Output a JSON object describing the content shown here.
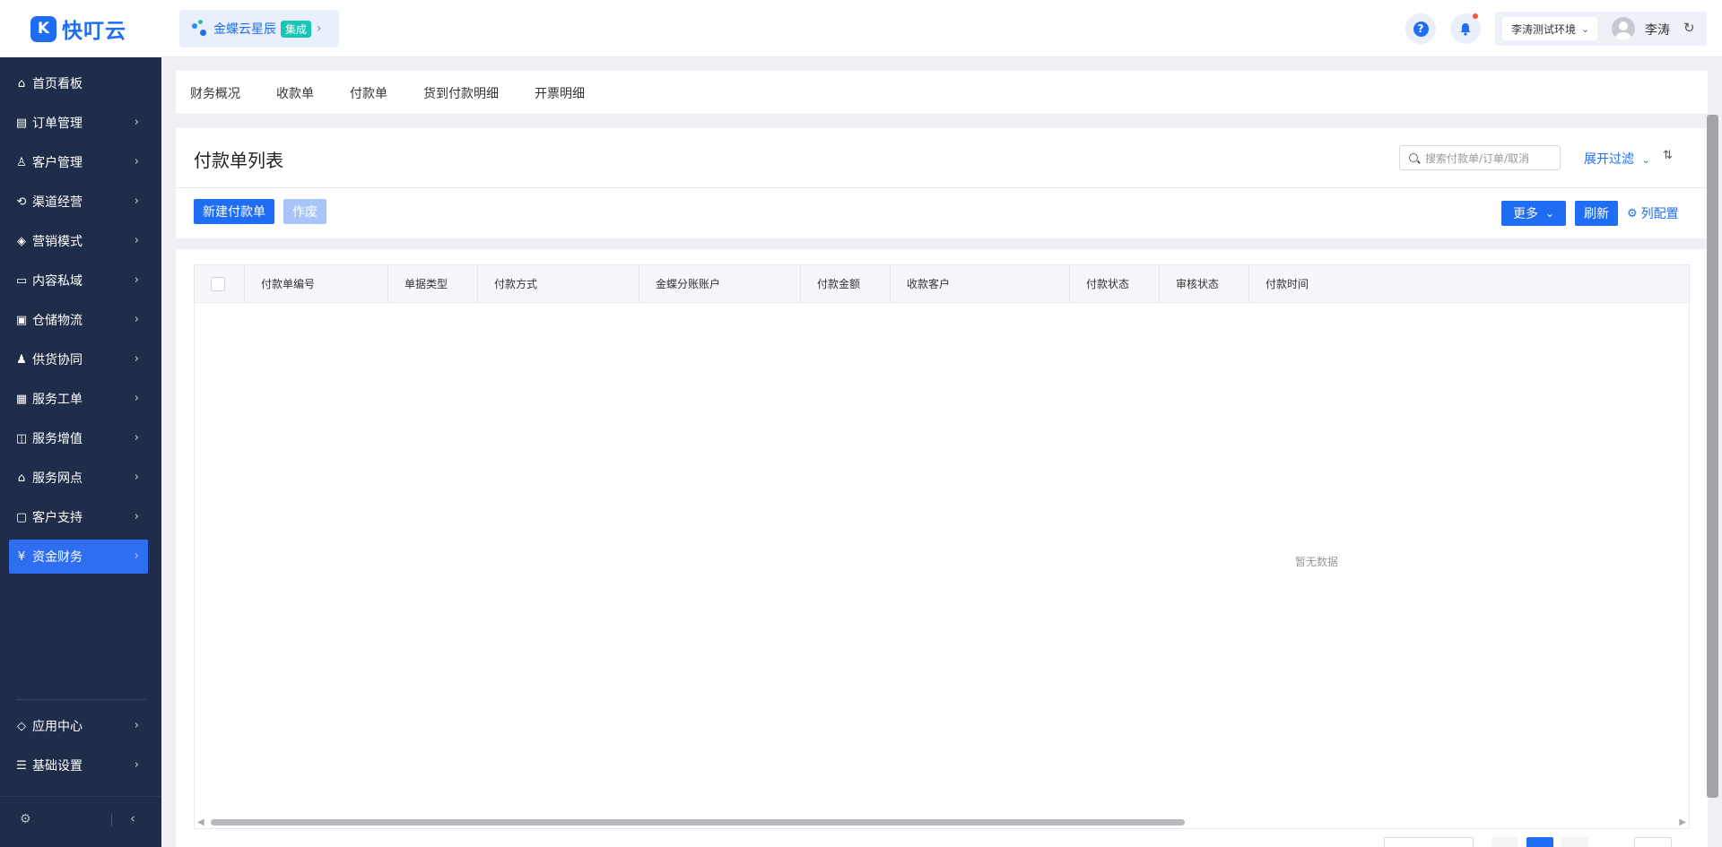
{
  "brand": {
    "logo_text": "快叮云"
  },
  "integration": {
    "label": "金蝶云星辰",
    "badge": "集成"
  },
  "header": {
    "help_label": "?",
    "env_label": "李涛测试环境",
    "user_name": "李涛"
  },
  "sidebar": {
    "items": [
      {
        "label": "首页看板",
        "icon": "home-icon",
        "glyph": "⌂",
        "chevron": false
      },
      {
        "label": "订单管理",
        "icon": "document-icon",
        "glyph": "▤",
        "chevron": true
      },
      {
        "label": "客户管理",
        "icon": "person-icon",
        "glyph": "♙",
        "chevron": true
      },
      {
        "label": "渠道经营",
        "icon": "channel-icon",
        "glyph": "⟲",
        "chevron": true
      },
      {
        "label": "营销模式",
        "icon": "tag-icon",
        "glyph": "◈",
        "chevron": true
      },
      {
        "label": "内容私域",
        "icon": "image-icon",
        "glyph": "▭",
        "chevron": true
      },
      {
        "label": "仓储物流",
        "icon": "box-icon",
        "glyph": "▣",
        "chevron": true
      },
      {
        "label": "供货协同",
        "icon": "supply-icon",
        "glyph": "♟",
        "chevron": true
      },
      {
        "label": "服务工单",
        "icon": "ticket-icon",
        "glyph": "▦",
        "chevron": true
      },
      {
        "label": "服务增值",
        "icon": "bag-icon",
        "glyph": "◫",
        "chevron": true
      },
      {
        "label": "服务网点",
        "icon": "store-icon",
        "glyph": "⌂",
        "chevron": true
      },
      {
        "label": "客户支持",
        "icon": "support-icon",
        "glyph": "▢",
        "chevron": true
      },
      {
        "label": "资金财务",
        "icon": "yen-icon",
        "glyph": "¥",
        "chevron": true,
        "active": true
      }
    ],
    "bottom_items": [
      {
        "label": "应用中心",
        "icon": "cube-icon",
        "glyph": "◇",
        "chevron": true
      },
      {
        "label": "基础设置",
        "icon": "sliders-icon",
        "glyph": "☰",
        "chevron": true
      }
    ]
  },
  "tabs": [
    "财务概况",
    "收款单",
    "付款单",
    "货到付款明细",
    "开票明细"
  ],
  "page": {
    "title": "付款单列表",
    "search_placeholder": "搜索付款单/订单/取消",
    "expand_filter": "展开过滤",
    "new_button": "新建付款单",
    "void_button": "作废",
    "more_button": "更多",
    "refresh_button": "刷新",
    "column_config": "列配置"
  },
  "table": {
    "columns": [
      "付款单编号",
      "单据类型",
      "付款方式",
      "金蝶分账账户",
      "付款金额",
      "收款客户",
      "付款状态",
      "审核状态",
      "付款时间"
    ],
    "rows": [],
    "empty_text": "暂无数据"
  },
  "colors": {
    "accent": "#1f6df2",
    "sidebar_bg": "#1f2d4a",
    "active_nav": "#2f6ef0",
    "badge": "#19c6b6"
  }
}
